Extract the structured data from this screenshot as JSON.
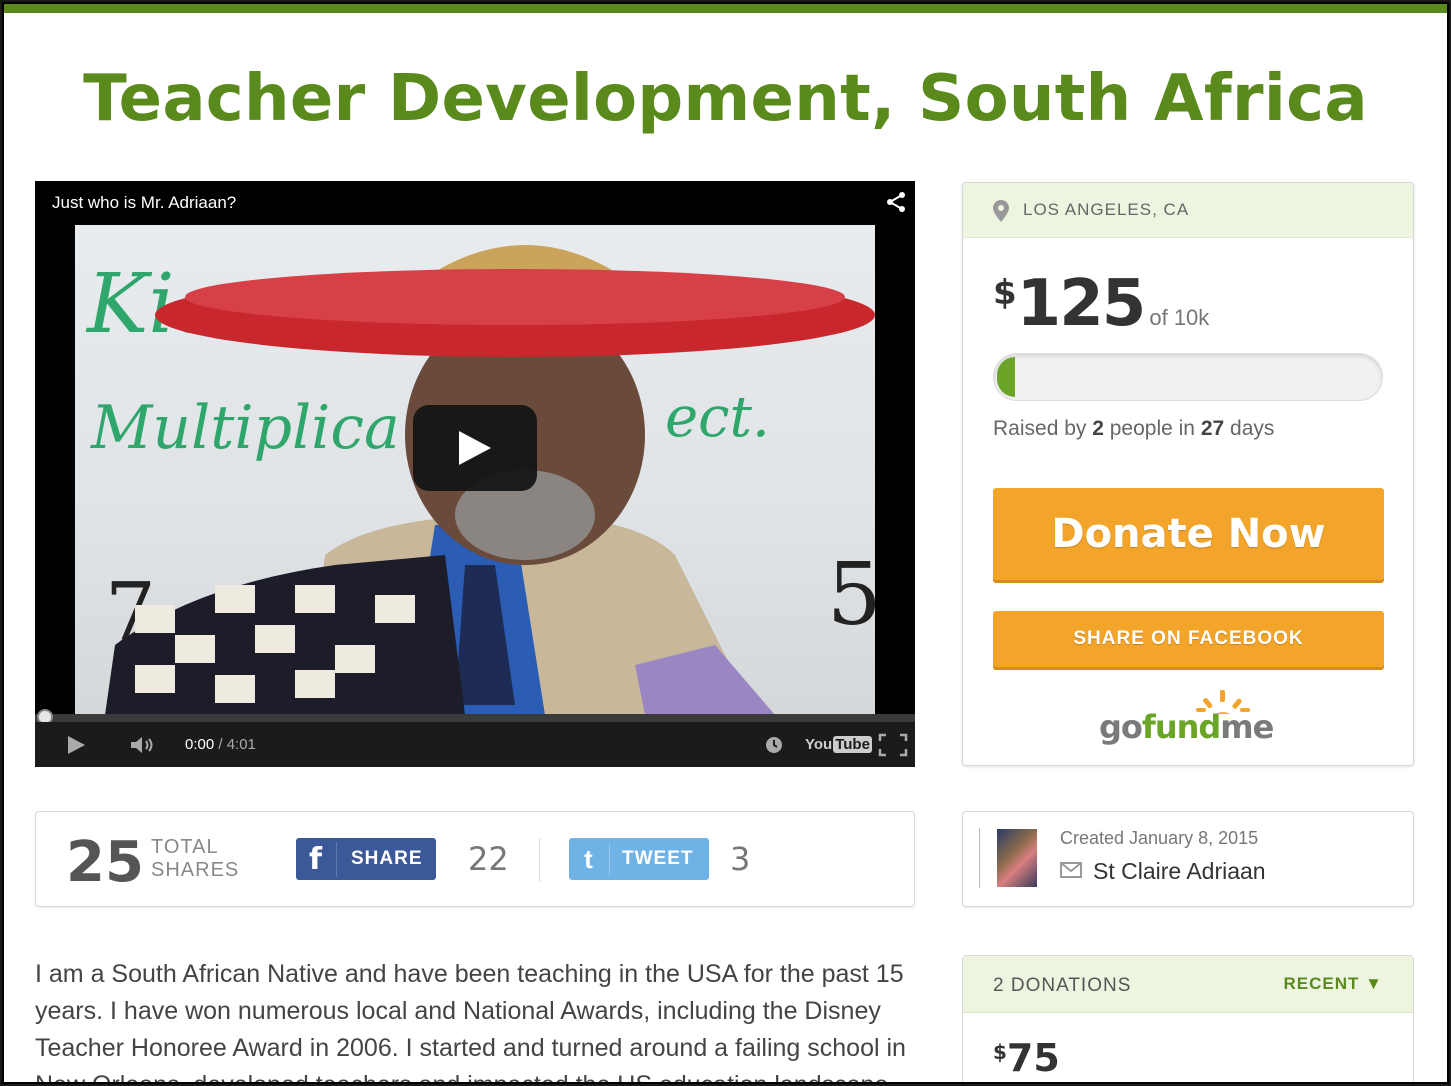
{
  "title": "Teacher Development, South Africa",
  "video": {
    "title": "Just who is Mr. Adriaan?",
    "time_current": "0:00",
    "time_total": "/ 4:01",
    "board_word": "Multiplica",
    "board_word2": "ect.",
    "board_top": "Kia",
    "board_num_left": "7",
    "board_num_right": "5",
    "youtube_you": "You",
    "youtube_tube": "Tube"
  },
  "shares": {
    "total": "25",
    "total_label_1": "TOTAL",
    "total_label_2": "SHARES",
    "facebook_label": "SHARE",
    "facebook_icon": "f",
    "facebook_count": "22",
    "twitter_label": "TWEET",
    "twitter_icon": "t",
    "twitter_count": "3"
  },
  "story": "I am a South African Native and have been teaching in the USA for the past 15 years. I have won numerous local and National Awards, including the Disney Teacher Honoree Award in 2006. I started and turned around a failing school in New Orleans, developed teachers and impacted the US education landscape",
  "campaign": {
    "location": "LOS ANGELES, CA",
    "currency": "$",
    "raised": "125",
    "goal": "of 10k",
    "progress_fraction": 0.0125,
    "raised_prefix": "Raised by ",
    "people": "2",
    "raised_mid": " people in ",
    "days": "27",
    "raised_suffix": " days",
    "donate_label": "Donate Now",
    "facebook_button": "SHARE ON FACEBOOK",
    "brand_go": "go",
    "brand_fund": "fund",
    "brand_me": "me"
  },
  "creator": {
    "created": "Created January 8, 2015",
    "name": "St Claire Adriaan"
  },
  "donations": {
    "count_label": "2 DONATIONS",
    "sort_label": "RECENT",
    "first_currency": "$",
    "first_amount": "75"
  },
  "colors": {
    "brand_green": "#5a8a1c",
    "donate_orange": "#f3a42a",
    "facebook_blue": "#3b5998",
    "twitter_blue": "#6fb2e6"
  }
}
